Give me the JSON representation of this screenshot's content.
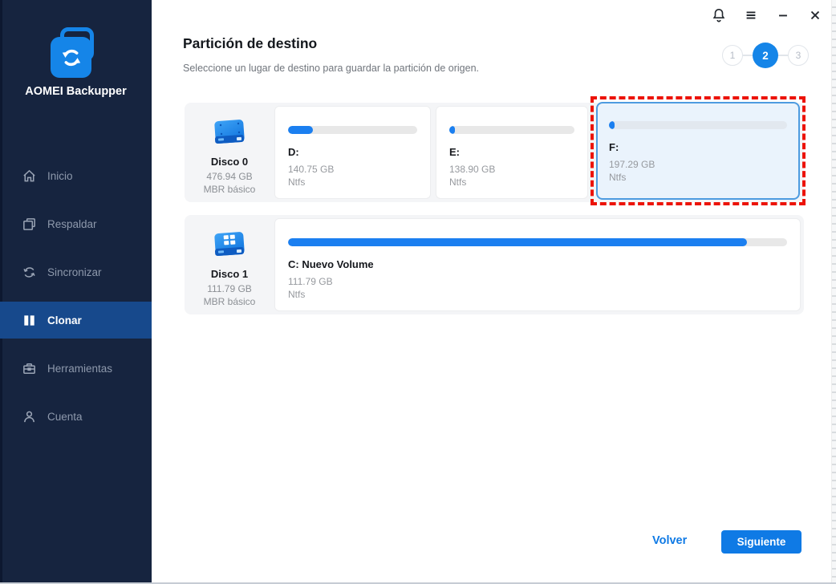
{
  "app": {
    "name": "AOMEI Backupper"
  },
  "titlebar": {
    "icons": [
      "notification-bell",
      "menu",
      "minimize",
      "close"
    ]
  },
  "sidebar": {
    "items": [
      {
        "label": "Inicio",
        "icon": "home-icon",
        "active": false
      },
      {
        "label": "Respaldar",
        "icon": "backup-icon",
        "active": false
      },
      {
        "label": "Sincronizar",
        "icon": "sync-icon",
        "active": false
      },
      {
        "label": "Clonar",
        "icon": "clone-icon",
        "active": true
      },
      {
        "label": "Herramientas",
        "icon": "tools-icon",
        "active": false
      },
      {
        "label": "Cuenta",
        "icon": "account-icon",
        "active": false
      }
    ]
  },
  "header": {
    "title": "Partición de destino",
    "subtitle": "Seleccione un lugar de destino para guardar la partición de origen."
  },
  "steps": {
    "labels": [
      "1",
      "2",
      "3"
    ],
    "active": "2"
  },
  "disks": [
    {
      "name": "Disco 0",
      "size": "476.94 GB",
      "type": "MBR básico",
      "partitions": [
        {
          "label": "D:",
          "size": "140.75 GB",
          "fs": "Ntfs",
          "usage_pct": 19,
          "selected": false
        },
        {
          "label": "E:",
          "size": "138.90 GB",
          "fs": "Ntfs",
          "usage_pct": 3,
          "selected": false
        },
        {
          "label": "F:",
          "size": "197.29 GB",
          "fs": "Ntfs",
          "usage_pct": 3,
          "selected": true
        }
      ]
    },
    {
      "name": "Disco 1",
      "size": "111.79 GB",
      "type": "MBR básico",
      "partitions": [
        {
          "label": "C: Nuevo Volume",
          "size": "111.79 GB",
          "fs": "Ntfs",
          "usage_pct": 92,
          "selected": false
        }
      ]
    }
  ],
  "footer": {
    "back": "Volver",
    "next": "Siguiente"
  },
  "colors": {
    "accent": "#1585E8",
    "sidebar_bg": "#16243F",
    "active_nav_bg": "#17498C",
    "bar_fill": "#1B7FF0",
    "selection_border": "#4D9BE0",
    "annotation_red": "#EC1308"
  }
}
